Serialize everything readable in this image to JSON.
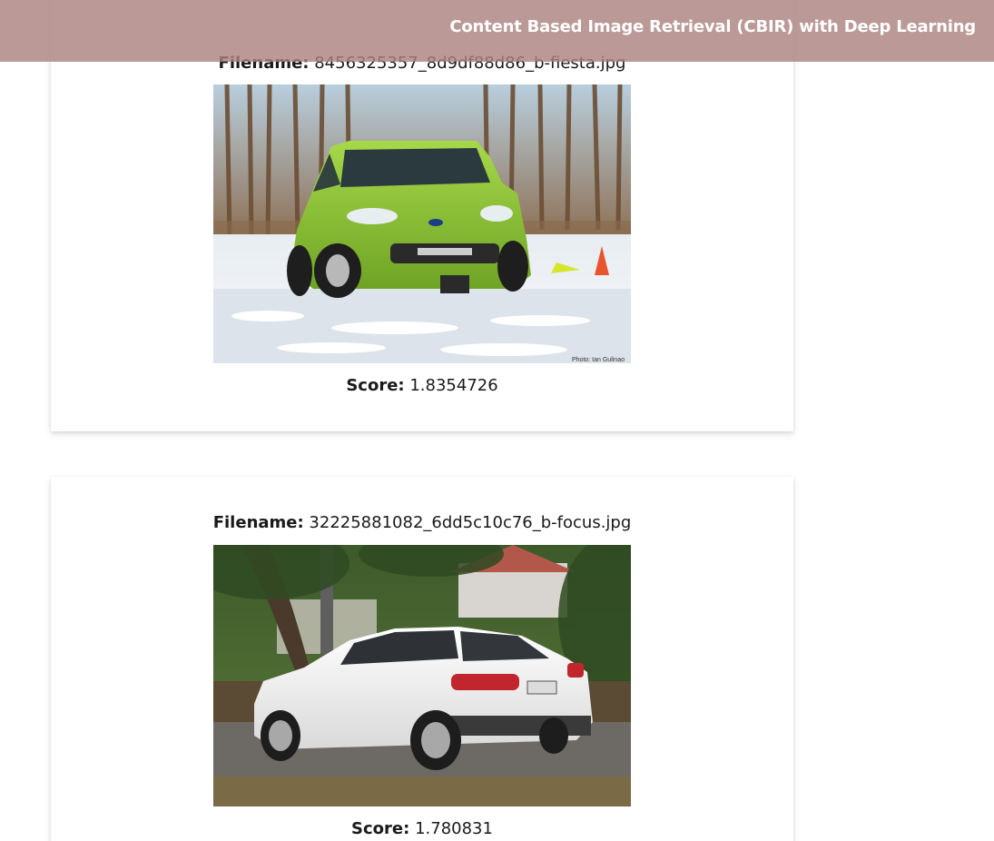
{
  "header": {
    "title": "Content Based Image Retrieval (CBIR) with Deep Learning"
  },
  "results": [
    {
      "filename_label": "Filename:",
      "filename": "8456325357_8d9df88d86_b-fiesta.jpg",
      "score_label": "Score:",
      "score": "1.8354726",
      "photo_credit": "Photo: Ian Gulinao"
    },
    {
      "filename_label": "Filename:",
      "filename": "32225881082_6dd5c10c76_b-focus.jpg",
      "score_label": "Score:",
      "score": "1.780831"
    }
  ],
  "colors": {
    "header_bg": "#ac827f",
    "header_text": "#ffffff",
    "car1_body": "#8cc63f",
    "car2_body": "#f2f2f2"
  }
}
